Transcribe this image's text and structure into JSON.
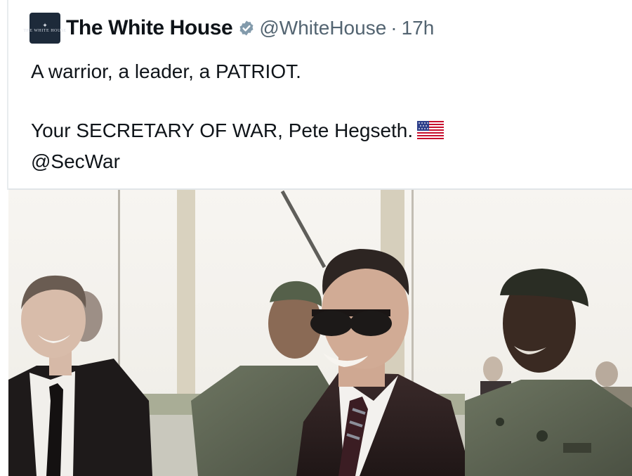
{
  "tweet": {
    "author": {
      "name": "The White House",
      "handle": "@WhiteHouse",
      "avatar_text": "THE WHITE HOUSE",
      "verified_icon": "verified-badge-icon"
    },
    "separator": "·",
    "time": "17h",
    "text": {
      "line1": "A warrior, a leader, a PATRIOT.",
      "line2": "Your SECRETARY OF WAR, Pete Hegseth.",
      "line3": "@SecWar"
    },
    "emoji": "us-flag-icon"
  },
  "media": {
    "type": "video-still",
    "subject": "men in suits and military uniforms outdoors"
  },
  "colors": {
    "text": "#0f1419",
    "secondary": "#536471",
    "verified": "#829aab",
    "avatar_bg": "#1d2a3a"
  }
}
